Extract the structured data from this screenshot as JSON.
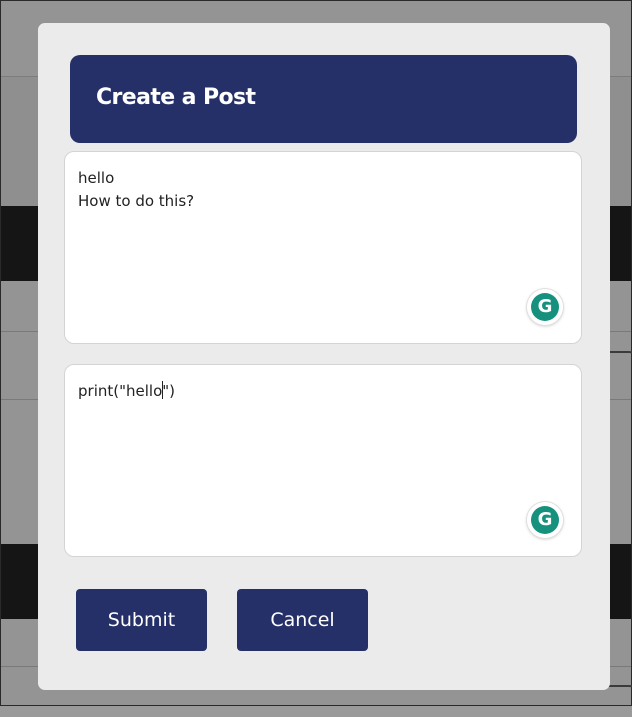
{
  "modal": {
    "title": "Create a Post",
    "description_text": {
      "line_1": "hello",
      "line_2": "How to do this?"
    },
    "code_text": {
      "before_caret": "print(\"hello",
      "after_caret": "\")"
    },
    "grammarly_icon_letter": "G",
    "submit_label": "Submit",
    "cancel_label": "Cancel"
  },
  "colors": {
    "accent": "#253068",
    "modal_bg": "#ebebeb",
    "grammarly": "#15917d"
  },
  "icons": [
    "grammarly-icon"
  ]
}
